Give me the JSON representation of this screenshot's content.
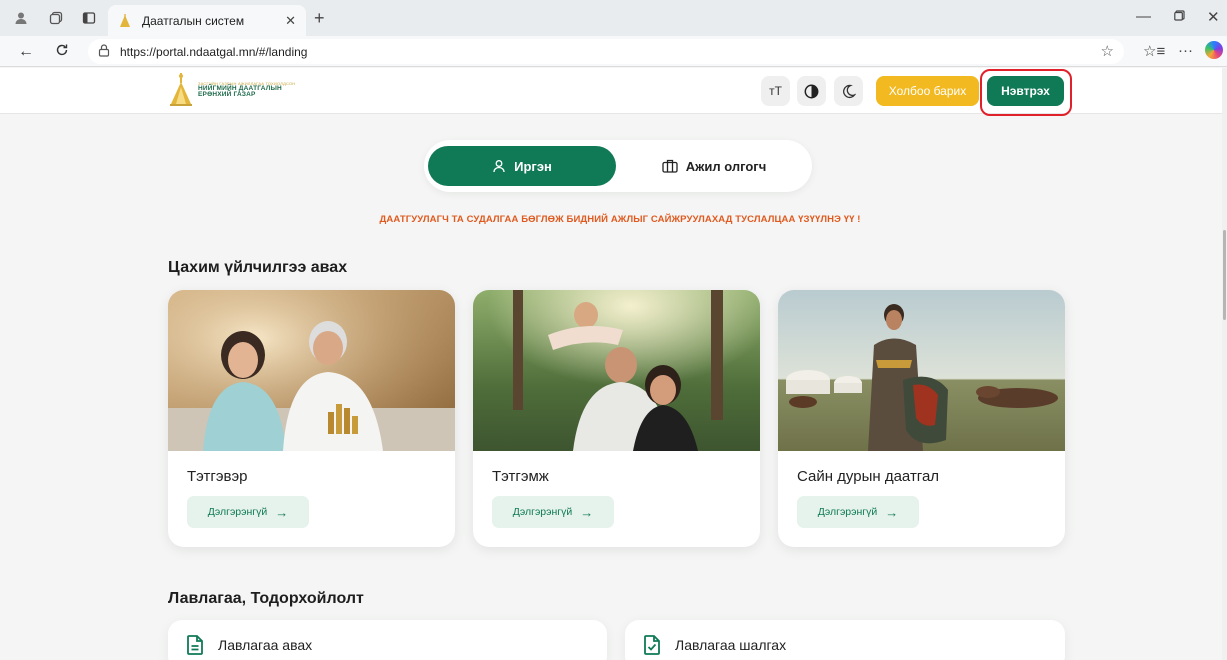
{
  "browser": {
    "tab_title": "Даатгалын систем",
    "url": "https://portal.ndaatgal.mn/#/landing"
  },
  "header": {
    "logo": {
      "small_line": "ЗАСГИЙН ГАЗРЫН АЖИЛЛАГАА ТОХИОЛДСОН",
      "line1": "НИЙГМИЙН ДААТГАЛЫН",
      "line2": "ЕРӨНХИЙ ГАЗАР"
    },
    "font_size_label": "тТ",
    "contact_label": "Холбоо барих",
    "login_label": "Нэвтрэх"
  },
  "switcher": {
    "citizen_label": "Иргэн",
    "employer_label": "Ажил олгогч"
  },
  "notice": "ДААТГУУЛАГЧ ТА СУДАЛГАА БӨГЛӨЖ БИДНИЙ АЖЛЫГ САЙЖРУУЛАХАД ТУСЛАЛЦАА ҮЗҮҮЛНЭ ҮҮ !",
  "services": {
    "title": "Цахим үйлчилгээ авах",
    "cards": [
      {
        "title": "Тэтгэвэр",
        "button": "Дэлгэрэнгүй"
      },
      {
        "title": "Тэтгэмж",
        "button": "Дэлгэрэнгүй"
      },
      {
        "title": "Сайн дурын даатгал",
        "button": "Дэлгэрэнгүй"
      }
    ]
  },
  "references": {
    "title": "Лавлагаа, Тодорхойлолт",
    "items": [
      {
        "label": "Лавлагаа авах"
      },
      {
        "label": "Лавлагаа шалгах"
      }
    ]
  },
  "colors": {
    "primary": "#0f7a55",
    "contact": "#f2b920",
    "notice": "#e05a1f",
    "highlight": "#e0202a"
  }
}
